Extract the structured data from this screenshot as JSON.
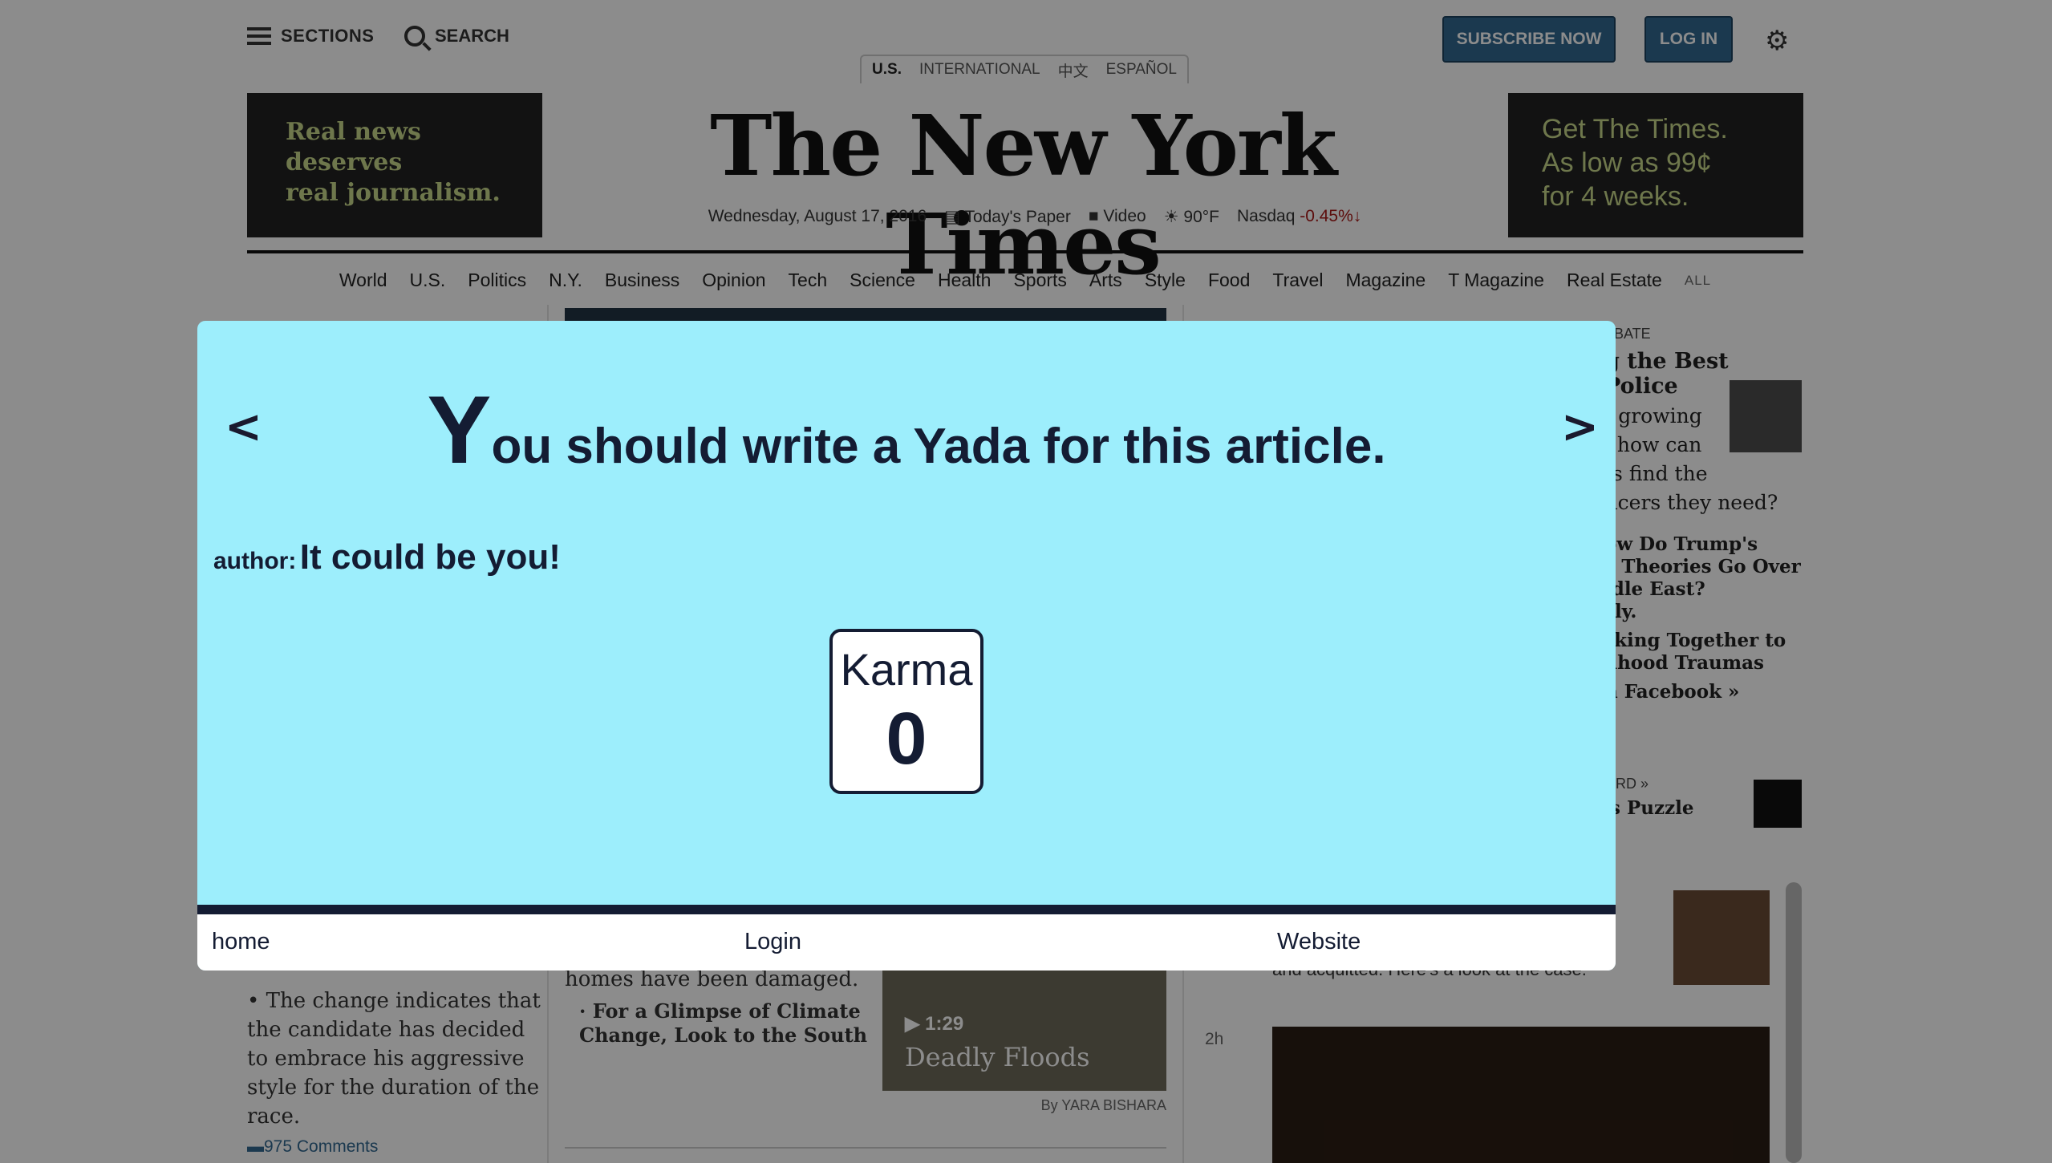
{
  "header": {
    "sections_label": "SECTIONS",
    "search_label": "SEARCH",
    "subscribe_label": "SUBSCRIBE NOW",
    "login_label": "LOG IN",
    "editions": [
      "U.S.",
      "INTERNATIONAL",
      "中文",
      "ESPAÑOL"
    ]
  },
  "ad_left": {
    "line1": "Real news",
    "line2": "deserves",
    "line3": "real journalism."
  },
  "ad_right": {
    "line1": "Get The Times.",
    "line2": "As low as 99¢",
    "line3": "for 4 weeks."
  },
  "logo": "The New York Times",
  "dateline": {
    "date": "Wednesday, August 17, 2016",
    "paper": "Today's Paper",
    "video": "Video",
    "weather": "90°F",
    "market_label": "Nasdaq",
    "market_value": "-0.45%"
  },
  "nav": [
    "World",
    "U.S.",
    "Politics",
    "N.Y.",
    "Business",
    "Opinion",
    "Tech",
    "Science",
    "Health",
    "Sports",
    "Arts",
    "Style",
    "Food",
    "Travel",
    "Magazine",
    "T Magazine",
    "Real Estate"
  ],
  "nav_all": "ALL",
  "left_col": {
    "bullet": "• The change indicates that the candidate has decided to embrace his aggressive style for the duration of the race.",
    "comments": "975 Comments"
  },
  "mid_col": {
    "text": "homes have been damaged.",
    "sub": "· For a Glimpse of Climate Change, Look to the South",
    "video_duration": "▶ 1:29",
    "video_title": "Deadly Floods",
    "byline": "By YARA BISHARA"
  },
  "right_col": {
    "debate_label": "EBATE",
    "headline": "g the Best Police",
    "l1": "f growing",
    "l2": ", how can",
    "l3": "ts find the",
    "l4": "ficers they need?",
    "h2": "ow Do Trump's",
    "h3": "y Theories Go Over",
    "h4": "ldle East?",
    "h5": "sly.",
    "h6": "rking Together to",
    "h7": "dhood Traumas",
    "h8": "n Facebook »",
    "cross_label": "ORD »",
    "puzzle": "'s Puzzle",
    "acquitted": "and acquitted. Here's a look at the case.",
    "time": "2h"
  },
  "modal": {
    "headline_cap": "Y",
    "headline_rest": "ou should write a Yada for this article.",
    "author_label": "author:",
    "author_value": "It could be you!",
    "karma_label": "Karma",
    "karma_value": "0",
    "footer": {
      "home": "home",
      "login": "Login",
      "website": "Website"
    },
    "bg_color": "#9deefc"
  }
}
